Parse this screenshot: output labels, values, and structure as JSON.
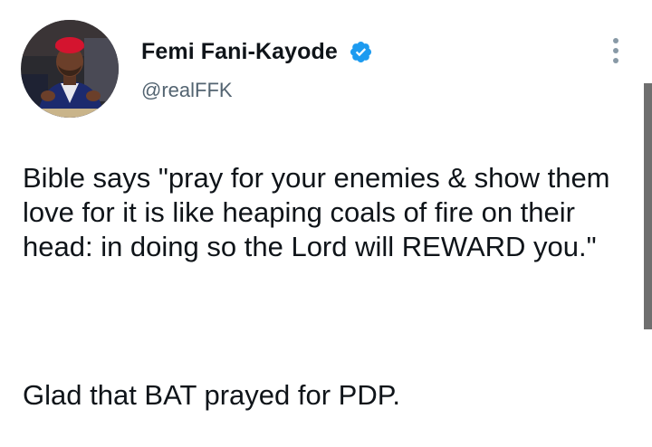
{
  "tweet": {
    "author": {
      "display_name": "Femi Fani-Kayode",
      "handle": "@realFFK",
      "verified": true
    },
    "text_paragraphs": [
      "Bible says \"pray for your enemies & show them love for it is like heaping coals of fire on their head: in doing so the Lord will REWARD you.\"",
      "Glad that BAT prayed for PDP."
    ]
  },
  "icons": {
    "verified": "verified-badge-icon",
    "more": "more-options-icon"
  },
  "colors": {
    "verified_blue": "#1d9bf0",
    "secondary_text": "#536471",
    "primary_text": "#0f1419",
    "more_dots": "#8899a6",
    "scrollbar": "#6f6f6f"
  }
}
